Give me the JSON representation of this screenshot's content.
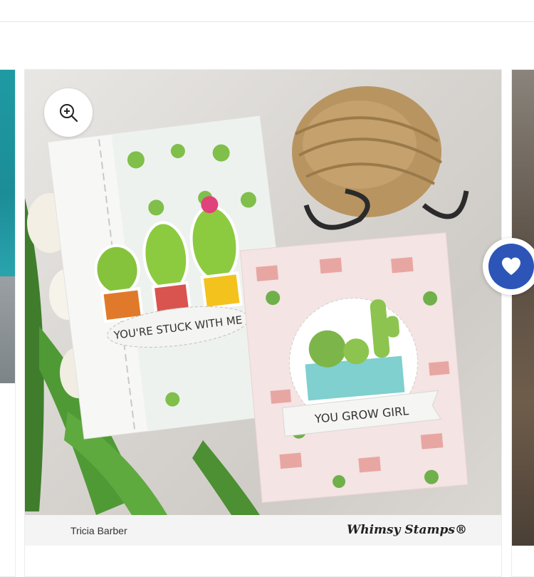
{
  "product": {
    "photographer": "Tricia Barber",
    "brand": "Whimsy Stamps®",
    "card_left_sentiment": "YOU'RE STUCK WITH ME",
    "card_right_sentiment": "YOU GROW GIRL"
  },
  "icons": {
    "zoom": "zoom-in-icon",
    "wishlist": "heart-icon"
  },
  "colors": {
    "wishlist_accent": "#2d55b8"
  }
}
